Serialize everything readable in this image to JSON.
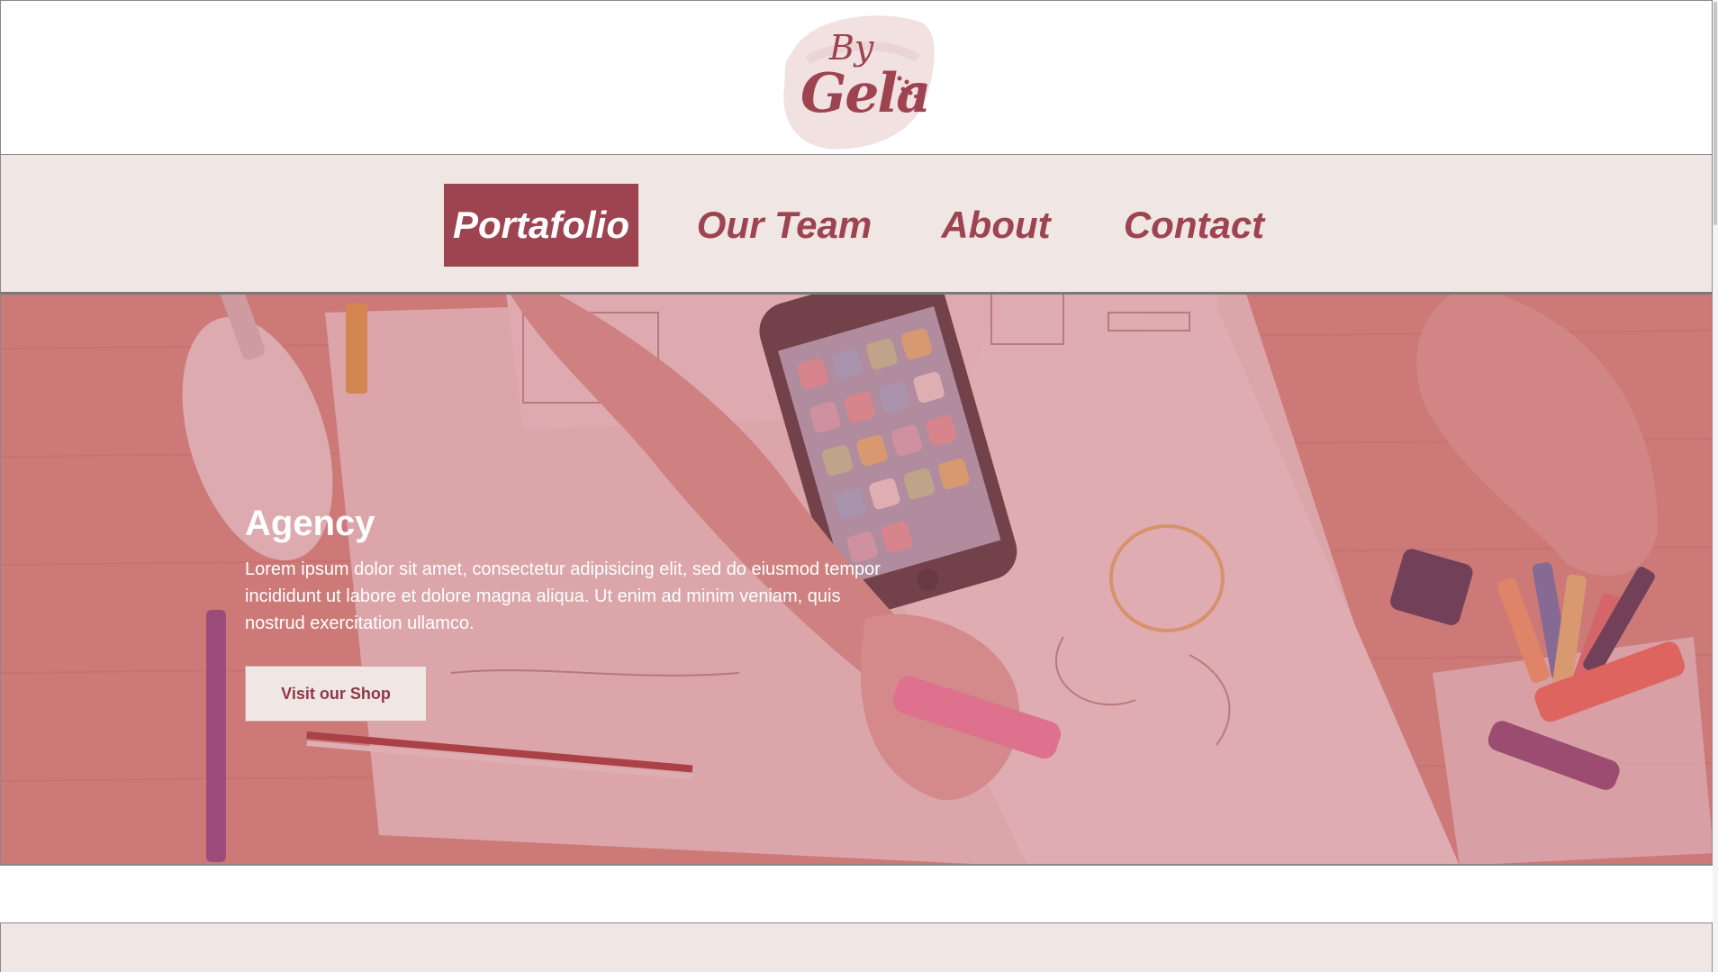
{
  "logo": {
    "top_text": "By",
    "name_text": "Gela"
  },
  "nav": {
    "items": [
      {
        "label": "Portafolio",
        "active": true
      },
      {
        "label": "Our Team",
        "active": false
      },
      {
        "label": "About",
        "active": false
      },
      {
        "label": "Contact",
        "active": false
      }
    ]
  },
  "hero": {
    "title": "Agency",
    "text": "Lorem ipsum dolor sit amet, consectetur adipisicing elit, sed do eiusmod tempor incididunt ut labore et dolore magna aliqua. Ut enim ad minim veniam, quis nostrud exercitation ullamco.",
    "button_label": "Visit our Shop",
    "background_icon": "desk-workspace-photo"
  },
  "colors": {
    "brand": "#9e4350",
    "nav_background": "#f0e6e4",
    "hero_tint": "#c06070"
  }
}
